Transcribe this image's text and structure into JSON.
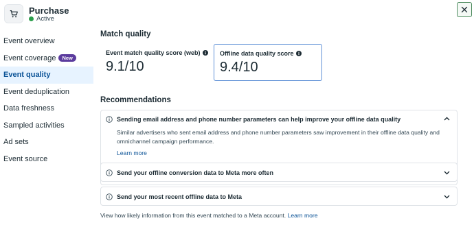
{
  "header": {
    "event_name": "Purchase",
    "status": "Active",
    "status_color": "#2b9e4b",
    "icon": "shopping-cart-icon",
    "close_icon": "close-icon"
  },
  "sidebar": {
    "items": [
      {
        "label": "Event overview"
      },
      {
        "label": "Event coverage",
        "badge": "New"
      },
      {
        "label": "Event quality",
        "active": true
      },
      {
        "label": "Event deduplication"
      },
      {
        "label": "Data freshness"
      },
      {
        "label": "Sampled activities"
      },
      {
        "label": "Ad sets"
      },
      {
        "label": "Event source"
      }
    ]
  },
  "main": {
    "section_title": "Match quality",
    "scores": {
      "web": {
        "label": "Event match quality score (web)",
        "value": "9.1/10"
      },
      "offline": {
        "label": "Offline data quality score",
        "value": "9.4/10"
      }
    },
    "recommendations_title": "Recommendations",
    "recommendations": [
      {
        "title": "Sending email address and phone number parameters can help improve your offline data quality",
        "body": "Similar advertisers who sent email address and phone number parameters saw improvement in their offline data quality and omnichannel campaign performance.",
        "link": "Learn more",
        "expanded": true
      },
      {
        "title": "Send your offline conversion data to Meta more often",
        "expanded": false
      },
      {
        "title": "Send your most recent offline data to Meta",
        "expanded": false
      }
    ],
    "footer": {
      "text": "View how likely information from this event matched to a Meta account.",
      "link": "Learn more"
    }
  },
  "colors": {
    "accent": "#0a5296",
    "active_bg": "#e7f3ff",
    "badge": "#5c3c9e",
    "card_border_selected": "#5d8fd6"
  }
}
